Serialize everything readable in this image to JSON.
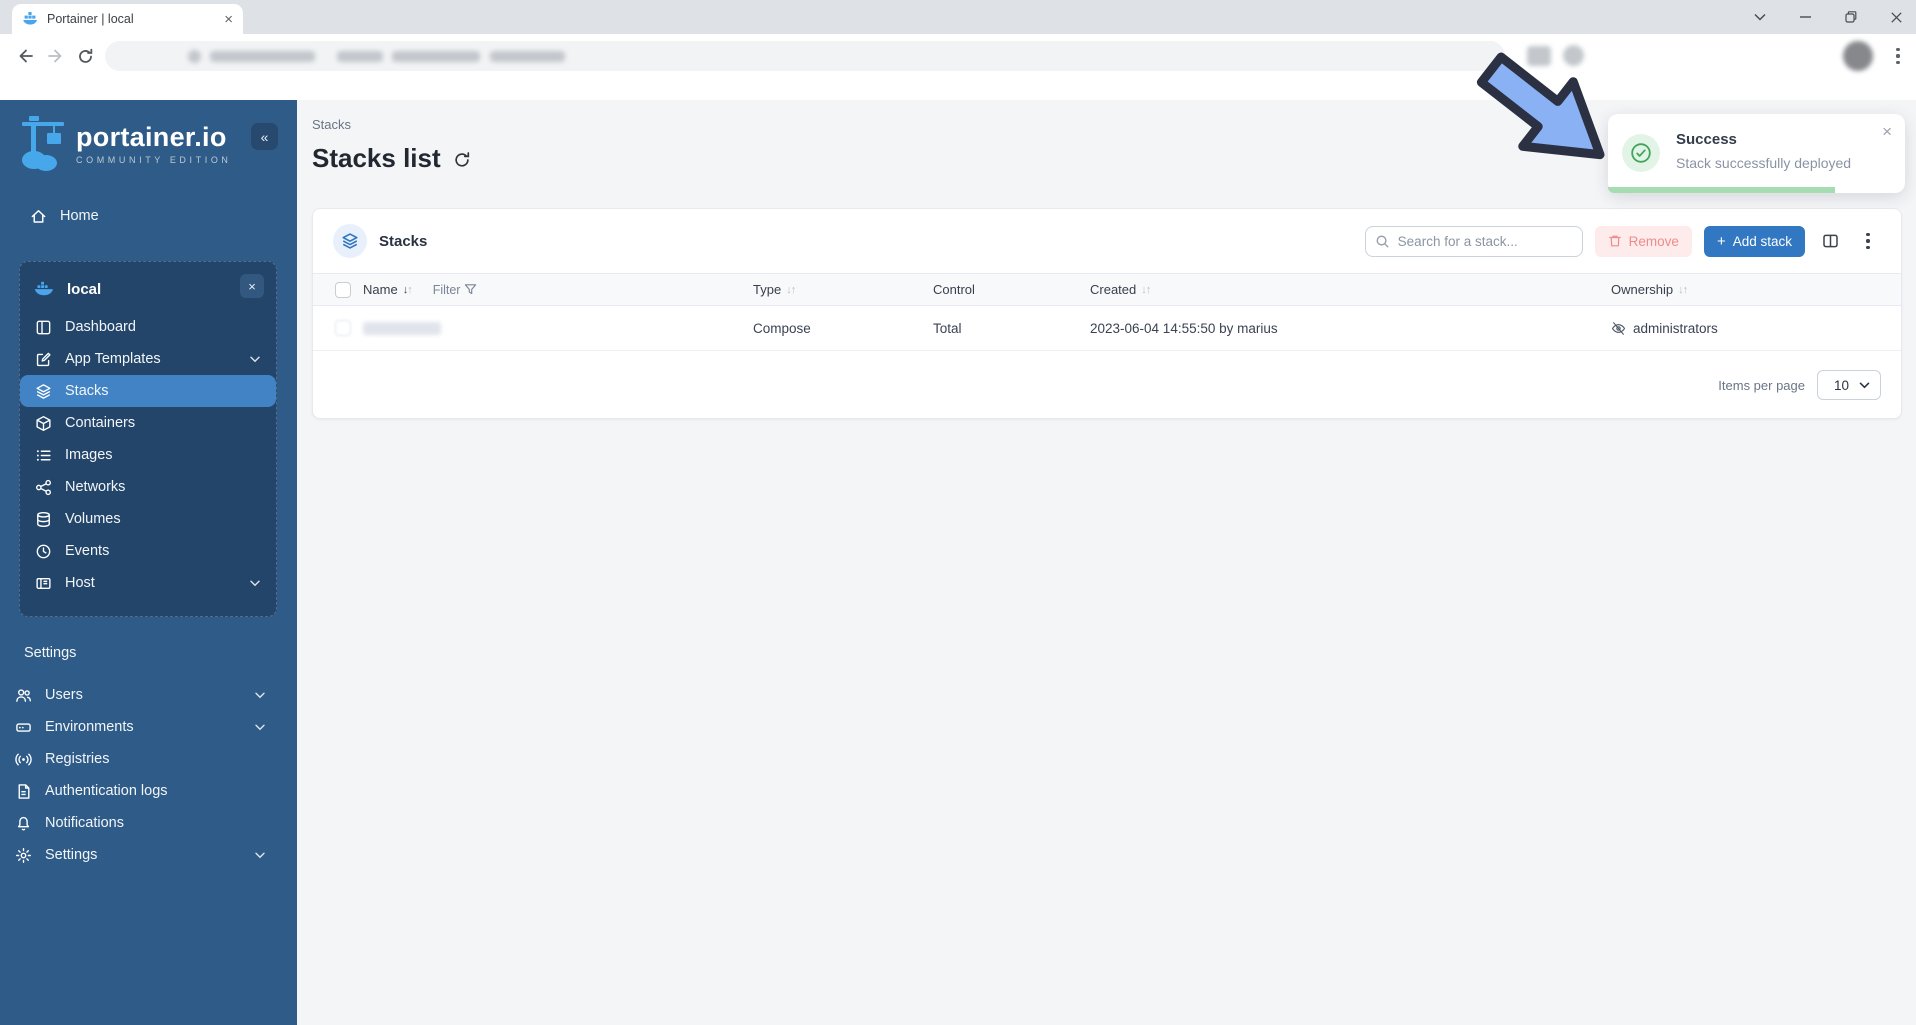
{
  "colors": {
    "brand_blue": "#3177c1",
    "sidebar_bg": "#2e5b87",
    "sidebar_box_bg": "#234569",
    "sidebar_active_bg": "#4183c4",
    "logo_blue": "#47a7eb",
    "success_green": "#43a35f",
    "toast_progress_green": "#a6dcb2",
    "remove_bg": "#fdeceb",
    "remove_text": "#ef8b8b",
    "content_bg": "#f4f5f7"
  },
  "browser": {
    "tab_title": "Portainer | local"
  },
  "sidebar": {
    "logo_title": "portainer.io",
    "logo_subtitle": "COMMUNITY EDITION",
    "home_label": "Home",
    "environment": {
      "name": "local",
      "items": [
        {
          "label": "Dashboard"
        },
        {
          "label": "App Templates",
          "chevron": true
        },
        {
          "label": "Stacks",
          "active": true
        },
        {
          "label": "Containers"
        },
        {
          "label": "Images"
        },
        {
          "label": "Networks"
        },
        {
          "label": "Volumes"
        },
        {
          "label": "Events"
        },
        {
          "label": "Host",
          "chevron": true
        }
      ]
    },
    "settings_header": "Settings",
    "settings_items": [
      {
        "label": "Users",
        "chevron": true
      },
      {
        "label": "Environments",
        "chevron": true
      },
      {
        "label": "Registries"
      },
      {
        "label": "Authentication logs"
      },
      {
        "label": "Notifications"
      },
      {
        "label": "Settings",
        "chevron": true
      }
    ]
  },
  "main": {
    "breadcrumb": "Stacks",
    "page_title": "Stacks list",
    "widget_title": "Stacks",
    "search_placeholder": "Search for a stack...",
    "remove_label": "Remove",
    "add_label": "Add stack",
    "plus_glyph": "+",
    "table": {
      "headers": {
        "name": "Name",
        "filter": "Filter",
        "type": "Type",
        "control": "Control",
        "created": "Created",
        "ownership": "Ownership"
      },
      "sort_down": "↓",
      "sort_up": "↑",
      "row": {
        "type": "Compose",
        "control": "Total",
        "created": "2023-06-04 14:55:50 by marius",
        "ownership": "administrators"
      }
    },
    "pagination": {
      "label": "Items per page",
      "value": "10"
    }
  },
  "toast": {
    "title": "Success",
    "message": "Stack successfully deployed"
  },
  "glyphs": {
    "collapse": "«",
    "close": "×"
  }
}
